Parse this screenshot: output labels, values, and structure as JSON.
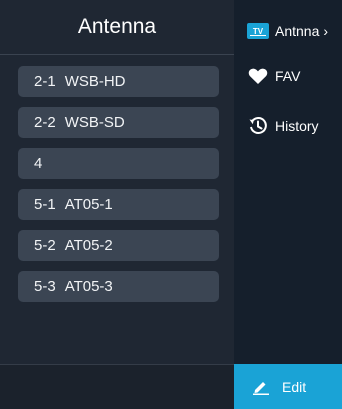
{
  "left_panel": {
    "title": "Antenna",
    "channels": [
      {
        "number": "2-1",
        "name": "WSB-HD"
      },
      {
        "number": "2-2",
        "name": "WSB-SD"
      },
      {
        "number": "4",
        "name": ""
      },
      {
        "number": "5-1",
        "name": "AT05-1"
      },
      {
        "number": "5-2",
        "name": "AT05-2"
      },
      {
        "number": "5-3",
        "name": "AT05-3"
      }
    ]
  },
  "right_menu": {
    "items": [
      {
        "label": "Antnna",
        "icon": "tv-icon",
        "icon_text": "TV",
        "has_chevron": true
      },
      {
        "label": "FAV",
        "icon": "heart-icon"
      },
      {
        "label": "History",
        "icon": "history-icon"
      }
    ],
    "chevron": "›"
  },
  "edit_button": {
    "label": "Edit",
    "icon": "pencil-icon"
  },
  "colors": {
    "accent": "#1aa3d6",
    "panel": "#1f2733",
    "item": "#3b4553",
    "menu": "#151f2c"
  }
}
